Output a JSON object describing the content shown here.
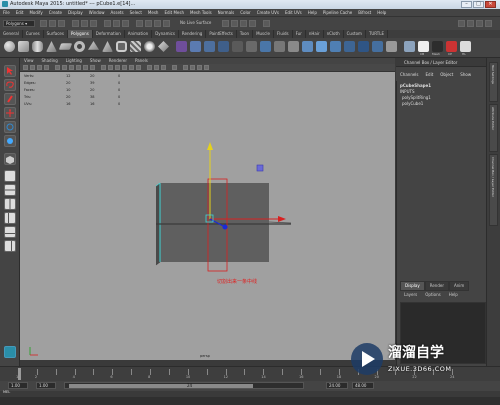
{
  "window": {
    "title": "Autodesk Maya 2015: untitled*  ---  pCube1.e[14]...",
    "minimize": "–",
    "maximize": "□",
    "close": "✕"
  },
  "menubar": [
    "File",
    "Edit",
    "Modify",
    "Create",
    "Display",
    "Window",
    "Assets",
    "Select",
    "Mesh",
    "Edit Mesh",
    "Mesh Tools",
    "Normals",
    "Color",
    "Create UVs",
    "Edit UVs",
    "Help",
    "Pipeline Cache",
    "Bifrost",
    "Help"
  ],
  "statusline": {
    "mode": "Polygons",
    "live_surface": "No Live Surface"
  },
  "shelf_tabs": [
    "General",
    "Curves",
    "Surfaces",
    "Polygons",
    "Deformation",
    "Animation",
    "Dynamics",
    "Rendering",
    "PaintEffects",
    "Toon",
    "Muscle",
    "Fluids",
    "Fur",
    "nHair",
    "nCloth",
    "Custom",
    "TURTLE"
  ],
  "shelf_tabs_active": "Polygons",
  "shelf_labels": [
    "CB",
    "Mesh",
    "CP",
    "HL"
  ],
  "viewport_menu": [
    "View",
    "Shading",
    "Lighting",
    "Show",
    "Renderer",
    "Panels"
  ],
  "hud": {
    "rows": [
      {
        "label": "Verts:",
        "a": "12",
        "b": "20",
        "c": "0"
      },
      {
        "label": "Edges:",
        "a": "20",
        "b": "39",
        "c": "0"
      },
      {
        "label": "Faces:",
        "a": "10",
        "b": "20",
        "c": "0"
      },
      {
        "label": "Tris:",
        "a": "20",
        "b": "38",
        "c": "0"
      },
      {
        "label": "UVs:",
        "a": "16",
        "b": "16",
        "c": "0"
      }
    ],
    "camera": "persp"
  },
  "annotation": "切割出来一条中线",
  "annotation_color": "#e02020",
  "channel_box": {
    "title": "Channel Box / Layer Editor",
    "menu": [
      "Channels",
      "Edit",
      "Object",
      "Show"
    ],
    "shape": "pCubeShape1",
    "inputs_header": "INPUTS",
    "inputs": [
      "polySplitRing1",
      "polyCube1"
    ]
  },
  "layer_editor": {
    "tabs": [
      "Display",
      "Render",
      "Anim"
    ],
    "active_tab": "Display",
    "menu": [
      "Layers",
      "Options",
      "Help"
    ]
  },
  "side_tabs": [
    "Tool Settings",
    "Attribute Editor",
    "Channel Box / Layer Editor"
  ],
  "timeline": {
    "ticks": [
      "1",
      "2",
      "3",
      "4",
      "5",
      "6",
      "7",
      "8",
      "9",
      "10",
      "11",
      "12",
      "13",
      "14",
      "15",
      "16",
      "17",
      "18",
      "19",
      "20",
      "21",
      "22",
      "23",
      "24"
    ]
  },
  "range": {
    "start": "1.00",
    "inner_start": "1.00",
    "inner_end": "24",
    "end": "24.00",
    "right_field": "48.00"
  },
  "command_line": {
    "mel": "MEL"
  },
  "watermark": {
    "title": "溜溜自学",
    "url": "ZIXUE.3D66.COM"
  },
  "colors": {
    "viewport_bg": "#a0a0a0",
    "cube_face": "#5e5e5e",
    "highlight_edge": "#3fd6d6",
    "manip_x": "#d92020",
    "manip_y": "#e6d21a",
    "manip_z": "#1a2ad9"
  }
}
